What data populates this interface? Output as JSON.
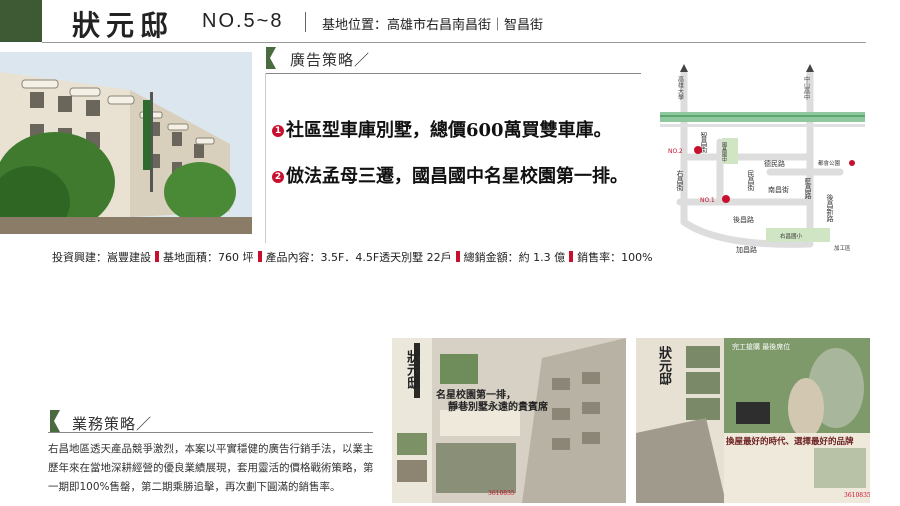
{
  "header": {
    "title": "狀元邸",
    "number": "NO.5~8",
    "location": "基地位置：高雄市右昌南昌街｜智昌街"
  },
  "ad_strategy": {
    "title": "廣告策略／",
    "points": [
      {
        "num": "1",
        "text": "社區型車庫別墅，總價600萬買雙車庫。"
      },
      {
        "num": "2",
        "text": "倣法孟母三遷，國昌國中名星校園第一排。"
      }
    ]
  },
  "map": {
    "north_labels": [
      "高雄大學",
      "中山高中"
    ],
    "roads": [
      "智昌街",
      "國昌國中",
      "右昌街",
      "德民路",
      "民昌街",
      "南昌街",
      "藍昌路",
      "後昌新路",
      "後昌路",
      "右昌國小",
      "加昌路"
    ],
    "markers": [
      "NO.2",
      "NO.1",
      "都會公園",
      "加工區"
    ]
  },
  "info": {
    "items": [
      "投資興建：嵩豐建設",
      "基地面積：760 坪",
      "產品內容：3.5F．4.5F透天別墅 22戶",
      "總銷金額：約 1.3 億",
      "銷售率：100%"
    ]
  },
  "business_strategy": {
    "title": "業務策略／",
    "text": "右昌地區透天產品競爭激烈，本案以平實穩健的廣告行銷手法，以業主歷年來在當地深耕經營的優良業績展現，套用靈活的價格戰術策略，第一期即100%售罄，第二期乘勝追擊，再次劃下圓滿的銷售率。"
  },
  "ads": {
    "ad1": {
      "logo": "狀元邸",
      "headline_1": "名星校園第一排，",
      "headline_2": "靜巷別墅永遠的貴賓席",
      "phone": "3610835"
    },
    "ad2": {
      "logo": "狀元邸",
      "top_right": "完工搶購 最後席位",
      "headline": "換屋最好的時代、選擇最好的品牌",
      "phone": "3610835"
    }
  },
  "colors": {
    "header_block": "#3d5a35",
    "accent_red": "#c8102e",
    "map_road_green": "#8fc79e",
    "map_label_green": "#cfe5c4"
  }
}
